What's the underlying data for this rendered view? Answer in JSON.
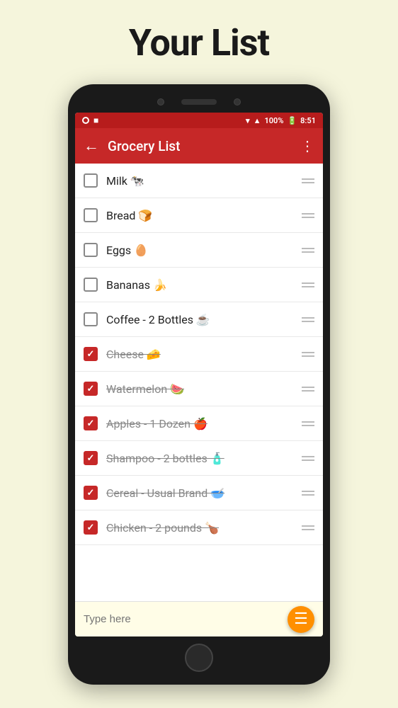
{
  "page": {
    "title": "Your List"
  },
  "status_bar": {
    "signal": "○",
    "sim": "■",
    "wifi": "▼",
    "signal_bars": "▲",
    "battery": "100%",
    "time": "8:51"
  },
  "toolbar": {
    "back_label": "←",
    "title": "Grocery List",
    "menu_label": "⋮"
  },
  "list_items": [
    {
      "id": 1,
      "text": "Milk 🐄",
      "checked": false
    },
    {
      "id": 2,
      "text": "Bread 🍞",
      "checked": false
    },
    {
      "id": 3,
      "text": "Eggs 🥚",
      "checked": false
    },
    {
      "id": 4,
      "text": "Bananas 🍌",
      "checked": false
    },
    {
      "id": 5,
      "text": "Coffee - 2 Bottles ☕",
      "checked": false
    },
    {
      "id": 6,
      "text": "Cheese 🧀",
      "checked": true
    },
    {
      "id": 7,
      "text": "Watermelon 🍉",
      "checked": true
    },
    {
      "id": 8,
      "text": "Apples - 1 Dozen 🍎",
      "checked": true
    },
    {
      "id": 9,
      "text": "Shampoo - 2 bottles 🧴",
      "checked": true
    },
    {
      "id": 10,
      "text": "Cereal - Usual Brand 🥣",
      "checked": true
    },
    {
      "id": 11,
      "text": "Chicken - 2 pounds 🍗",
      "checked": true
    }
  ],
  "bottom_bar": {
    "placeholder": "Type here",
    "fab_icon": "≡+"
  }
}
